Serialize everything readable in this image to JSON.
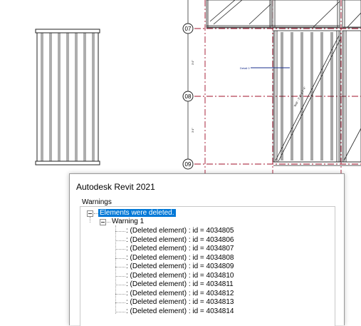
{
  "colors": {
    "selection": "#0078d7",
    "grid_line": "#a0102a",
    "detail_line": "#1a2f8c"
  },
  "drawing": {
    "grid_markers": [
      "07",
      "08",
      "09"
    ],
    "dim_labels": [
      "3'4\"",
      "3'4\""
    ],
    "annotation": "Detail 0",
    "diagonal_label": "Wall - 3'-0\" x 7'-4\""
  },
  "dialog": {
    "title": "Autodesk Revit 2021",
    "warnings_label": "Warnings",
    "tree": {
      "root": "Elements were deleted.",
      "group": "Warning 1",
      "items": [
        ": (Deleted element) : id = 4034805",
        ": (Deleted element) : id = 4034806",
        ": (Deleted element) : id = 4034807",
        ": (Deleted element) : id = 4034808",
        ": (Deleted element) : id = 4034809",
        ": (Deleted element) : id = 4034810",
        ": (Deleted element) : id = 4034811",
        ": (Deleted element) : id = 4034812",
        ": (Deleted element) : id = 4034813",
        ": (Deleted element) : id = 4034814"
      ]
    }
  }
}
